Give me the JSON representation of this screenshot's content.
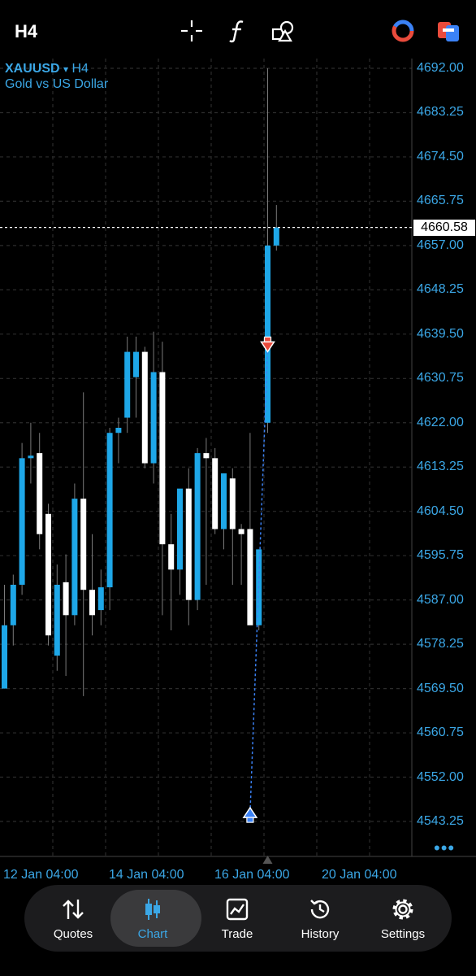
{
  "topbar": {
    "timeframe": "H4",
    "icons": [
      "crosshair-icon",
      "function-icon",
      "objects-icon",
      "trade-sync-icon",
      "accounts-icon"
    ]
  },
  "chart_header": {
    "symbol": "XAUUSD",
    "arrow": "▾",
    "timeframe": "H4",
    "description": "Gold vs US Dollar"
  },
  "chart_data": {
    "type": "candlestick",
    "symbol": "XAUUSD",
    "timeframe": "H4",
    "ylim": [
      4537,
      4697
    ],
    "y_ticks": [
      "4692.00",
      "4683.25",
      "4674.50",
      "4665.75",
      "4657.00",
      "4648.25",
      "4639.50",
      "4630.75",
      "4622.00",
      "4613.25",
      "4604.50",
      "4595.75",
      "4587.00",
      "4578.25",
      "4569.50",
      "4560.75",
      "4552.00",
      "4543.25"
    ],
    "x_labels": [
      "12 Jan 04:00",
      "14 Jan 04:00",
      "16 Jan 04:00",
      "20 Jan 04:00"
    ],
    "current_price": "4660.58",
    "colors": {
      "bull": "#1ea7e8",
      "bear": "#ffffff",
      "grid": "#2c2c2c",
      "axis": "#3ba7e6"
    },
    "candles": [
      {
        "o": 4569.5,
        "h": 4590.0,
        "l": 4569.5,
        "c": 4582.0
      },
      {
        "o": 4582.0,
        "h": 4592.0,
        "l": 4578.0,
        "c": 4590.0
      },
      {
        "o": 4590.0,
        "h": 4618.0,
        "l": 4588.0,
        "c": 4615.0
      },
      {
        "o": 4615.0,
        "h": 4622.0,
        "l": 4610.0,
        "c": 4615.5
      },
      {
        "o": 4616.0,
        "h": 4620.0,
        "l": 4597.0,
        "c": 4600.0
      },
      {
        "o": 4604.0,
        "h": 4606.0,
        "l": 4578.0,
        "c": 4580.0
      },
      {
        "o": 4576.0,
        "h": 4594.0,
        "l": 4573.0,
        "c": 4590.0
      },
      {
        "o": 4590.5,
        "h": 4596.0,
        "l": 4572.0,
        "c": 4584.0
      },
      {
        "o": 4584.0,
        "h": 4610.0,
        "l": 4582.0,
        "c": 4607.0
      },
      {
        "o": 4607.0,
        "h": 4628.0,
        "l": 4568.0,
        "c": 4589.0
      },
      {
        "o": 4589.0,
        "h": 4600.0,
        "l": 4580.0,
        "c": 4584.0
      },
      {
        "o": 4585.0,
        "h": 4593.0,
        "l": 4582.0,
        "c": 4589.5
      },
      {
        "o": 4589.5,
        "h": 4621.0,
        "l": 4585.0,
        "c": 4620.0
      },
      {
        "o": 4620.0,
        "h": 4623.0,
        "l": 4614.0,
        "c": 4621.0
      },
      {
        "o": 4623.0,
        "h": 4639.0,
        "l": 4620.0,
        "c": 4636.0
      },
      {
        "o": 4631.0,
        "h": 4639.0,
        "l": 4623.0,
        "c": 4636.0
      },
      {
        "o": 4636.0,
        "h": 4637.0,
        "l": 4613.0,
        "c": 4614.0
      },
      {
        "o": 4614.0,
        "h": 4640.0,
        "l": 4610.0,
        "c": 4632.0
      },
      {
        "o": 4632.0,
        "h": 4638.0,
        "l": 4584.0,
        "c": 4598.0
      },
      {
        "o": 4598.0,
        "h": 4604.0,
        "l": 4581.0,
        "c": 4593.0
      },
      {
        "o": 4593.0,
        "h": 4606.0,
        "l": 4588.0,
        "c": 4609.0
      },
      {
        "o": 4609.0,
        "h": 4613.0,
        "l": 4582.0,
        "c": 4587.0
      },
      {
        "o": 4587.0,
        "h": 4617.0,
        "l": 4585.0,
        "c": 4616.0
      },
      {
        "o": 4616.0,
        "h": 4619.0,
        "l": 4590.0,
        "c": 4615.0
      },
      {
        "o": 4615.0,
        "h": 4617.0,
        "l": 4600.0,
        "c": 4601.0
      },
      {
        "o": 4601.0,
        "h": 4612.0,
        "l": 4597.0,
        "c": 4612.0
      },
      {
        "o": 4611.0,
        "h": 4613.0,
        "l": 4590.0,
        "c": 4601.0
      },
      {
        "o": 4601.0,
        "h": 4602.0,
        "l": 4590.0,
        "c": 4600.0
      },
      {
        "o": 4601.0,
        "h": 4620.0,
        "l": 4583.0,
        "c": 4582.0
      },
      {
        "o": 4582.0,
        "h": 4597.0,
        "l": 4581.0,
        "c": 4597.0
      },
      {
        "o": 4622.0,
        "h": 4692.0,
        "l": 4620.0,
        "c": 4657.0
      },
      {
        "o": 4657.0,
        "h": 4665.0,
        "l": 4656.0,
        "c": 4660.58
      }
    ],
    "trades": [
      {
        "type": "buy",
        "price": 4545.0,
        "bar": 28
      },
      {
        "type": "sell",
        "price": 4637.0,
        "bar": 30
      }
    ]
  },
  "tabs": [
    {
      "label": "Quotes",
      "icon": "quotes-arrows-icon",
      "active": false
    },
    {
      "label": "Chart",
      "icon": "chart-candles-icon",
      "active": true
    },
    {
      "label": "Trade",
      "icon": "trade-chart-icon",
      "active": false
    },
    {
      "label": "History",
      "icon": "history-clock-icon",
      "active": false
    },
    {
      "label": "Settings",
      "icon": "settings-gear-icon",
      "active": false
    }
  ]
}
